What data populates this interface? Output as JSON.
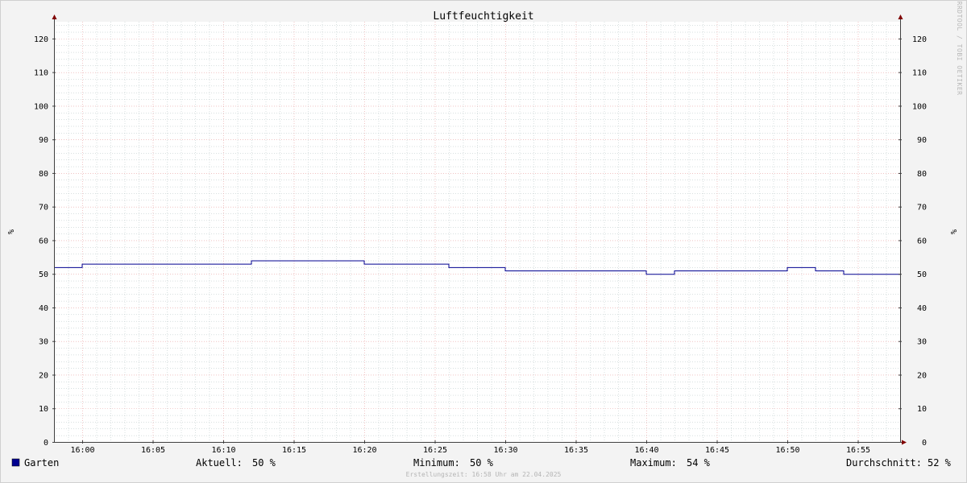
{
  "chart_data": {
    "type": "line",
    "title": "Luftfeuchtigkeit",
    "ylabel": "%",
    "ylim": [
      0,
      125
    ],
    "y_ticks": [
      0,
      10,
      20,
      30,
      40,
      50,
      60,
      70,
      80,
      90,
      100,
      110,
      120
    ],
    "xlim": [
      "15:58",
      "16:58"
    ],
    "x_ticks": [
      "16:00",
      "16:05",
      "16:10",
      "16:15",
      "16:20",
      "16:25",
      "16:30",
      "16:35",
      "16:40",
      "16:45",
      "16:50",
      "16:55"
    ],
    "grid": true,
    "legend_position": "bottom-left",
    "series": [
      {
        "name": "Garten",
        "color": "#000090",
        "x": [
          "15:58",
          "16:00",
          "16:12",
          "16:20",
          "16:26",
          "16:30",
          "16:40",
          "16:42",
          "16:50",
          "16:52",
          "16:54",
          "16:58"
        ],
        "y": [
          52,
          53,
          54,
          53,
          52,
          51,
          50,
          51,
          52,
          51,
          50,
          50
        ]
      }
    ]
  },
  "watermark": "RRDTOOL / TOBI OETIKER",
  "legend": {
    "series_name": "Garten",
    "current_label": "Aktuell:",
    "current_value": "50 %",
    "min_label": "Minimum:",
    "min_value": "50 %",
    "max_label": "Maximum:",
    "max_value": "54 %",
    "avg_label": "Durchschnitt:",
    "avg_value": "52 %"
  },
  "created": "Erstellungszeit: 16:58 Uhr am 22.04.2025",
  "colors": {
    "major_grid": "#e8a0a0",
    "minor_grid": "#b0c0c0",
    "axis": "#404040",
    "arrow": "#800000",
    "plot_bg": "#ffffff"
  }
}
